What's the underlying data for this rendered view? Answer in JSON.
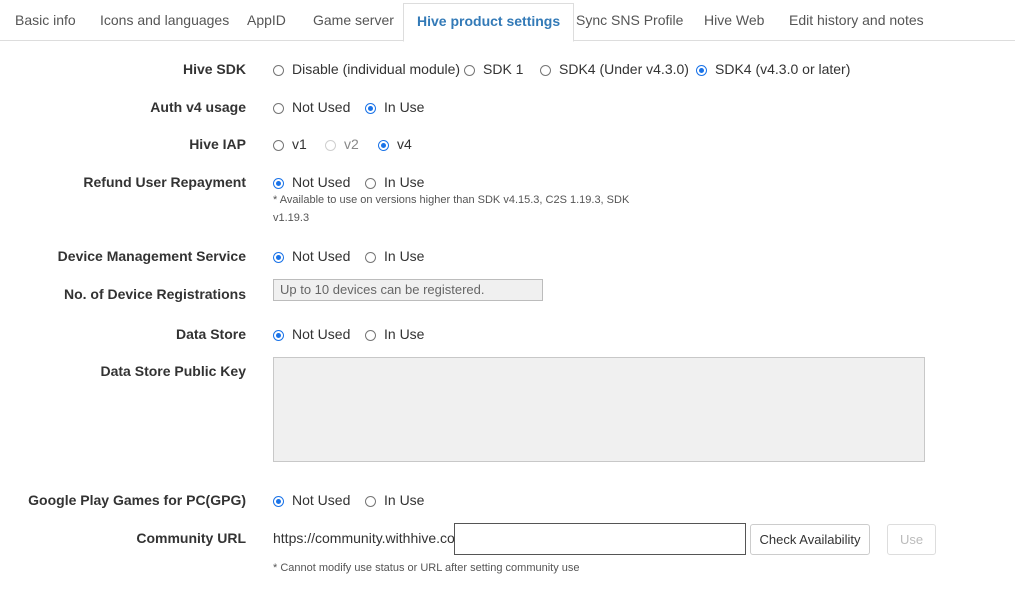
{
  "tabs": [
    {
      "label": "Basic info"
    },
    {
      "label": "Icons and languages"
    },
    {
      "label": "AppID"
    },
    {
      "label": "Game server"
    },
    {
      "label": "Hive product settings"
    },
    {
      "label": "Sync SNS Profile"
    },
    {
      "label": "Hive Web"
    },
    {
      "label": "Edit history and notes"
    }
  ],
  "active_tab": "Hive product settings",
  "accent_color": "#337ab7",
  "radio_color": "#1a73e8",
  "hive_sdk": {
    "label": "Hive SDK",
    "options": [
      "Disable (individual module)",
      "SDK 1",
      "SDK4 (Under v4.3.0)",
      "SDK4 (v4.3.0 or later)"
    ],
    "selected": "SDK4 (v4.3.0 or later)"
  },
  "auth_v4": {
    "label": "Auth v4 usage",
    "options": [
      "Not Used",
      "In Use"
    ],
    "selected": "In Use"
  },
  "hive_iap": {
    "label": "Hive IAP",
    "options": [
      "v1",
      "v2",
      "v4"
    ],
    "disabled": [
      "v2"
    ],
    "selected": "v4"
  },
  "refund": {
    "label": "Refund User Repayment",
    "options": [
      "Not Used",
      "In Use"
    ],
    "selected": "Not Used",
    "note_line1": "* Available to use on versions higher than SDK v4.15.3, C2S 1.19.3, SDK",
    "note_line2": "v1.19.3"
  },
  "device_mgmt": {
    "label": "Device Management Service",
    "options": [
      "Not Used",
      "In Use"
    ],
    "selected": "Not Used"
  },
  "device_reg": {
    "label": "No. of Device Registrations",
    "placeholder": "Up to 10 devices can be registered."
  },
  "data_store": {
    "label": "Data Store",
    "options": [
      "Not Used",
      "In Use"
    ],
    "selected": "Not Used"
  },
  "data_store_key": {
    "label": "Data Store Public Key",
    "value": ""
  },
  "gpg": {
    "label": "Google Play Games for PC(GPG)",
    "options": [
      "Not Used",
      "In Use"
    ],
    "selected": "Not Used"
  },
  "community": {
    "label": "Community URL",
    "prefix": "https://community.withhive.com/",
    "value": "",
    "check_button": "Check Availability",
    "use_button": "Use",
    "note": "* Cannot modify use status or URL after setting community use"
  }
}
